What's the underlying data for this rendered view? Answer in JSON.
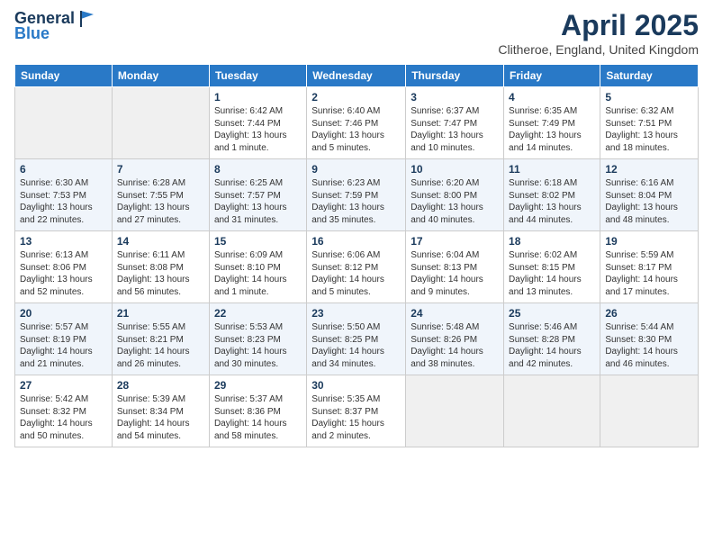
{
  "header": {
    "logo_line1": "General",
    "logo_line2": "Blue",
    "title": "April 2025",
    "subtitle": "Clitheroe, England, United Kingdom"
  },
  "days_of_week": [
    "Sunday",
    "Monday",
    "Tuesday",
    "Wednesday",
    "Thursday",
    "Friday",
    "Saturday"
  ],
  "weeks": [
    [
      {
        "day": "",
        "info": ""
      },
      {
        "day": "",
        "info": ""
      },
      {
        "day": "1",
        "info": "Sunrise: 6:42 AM\nSunset: 7:44 PM\nDaylight: 13 hours and 1 minute."
      },
      {
        "day": "2",
        "info": "Sunrise: 6:40 AM\nSunset: 7:46 PM\nDaylight: 13 hours and 5 minutes."
      },
      {
        "day": "3",
        "info": "Sunrise: 6:37 AM\nSunset: 7:47 PM\nDaylight: 13 hours and 10 minutes."
      },
      {
        "day": "4",
        "info": "Sunrise: 6:35 AM\nSunset: 7:49 PM\nDaylight: 13 hours and 14 minutes."
      },
      {
        "day": "5",
        "info": "Sunrise: 6:32 AM\nSunset: 7:51 PM\nDaylight: 13 hours and 18 minutes."
      }
    ],
    [
      {
        "day": "6",
        "info": "Sunrise: 6:30 AM\nSunset: 7:53 PM\nDaylight: 13 hours and 22 minutes."
      },
      {
        "day": "7",
        "info": "Sunrise: 6:28 AM\nSunset: 7:55 PM\nDaylight: 13 hours and 27 minutes."
      },
      {
        "day": "8",
        "info": "Sunrise: 6:25 AM\nSunset: 7:57 PM\nDaylight: 13 hours and 31 minutes."
      },
      {
        "day": "9",
        "info": "Sunrise: 6:23 AM\nSunset: 7:59 PM\nDaylight: 13 hours and 35 minutes."
      },
      {
        "day": "10",
        "info": "Sunrise: 6:20 AM\nSunset: 8:00 PM\nDaylight: 13 hours and 40 minutes."
      },
      {
        "day": "11",
        "info": "Sunrise: 6:18 AM\nSunset: 8:02 PM\nDaylight: 13 hours and 44 minutes."
      },
      {
        "day": "12",
        "info": "Sunrise: 6:16 AM\nSunset: 8:04 PM\nDaylight: 13 hours and 48 minutes."
      }
    ],
    [
      {
        "day": "13",
        "info": "Sunrise: 6:13 AM\nSunset: 8:06 PM\nDaylight: 13 hours and 52 minutes."
      },
      {
        "day": "14",
        "info": "Sunrise: 6:11 AM\nSunset: 8:08 PM\nDaylight: 13 hours and 56 minutes."
      },
      {
        "day": "15",
        "info": "Sunrise: 6:09 AM\nSunset: 8:10 PM\nDaylight: 14 hours and 1 minute."
      },
      {
        "day": "16",
        "info": "Sunrise: 6:06 AM\nSunset: 8:12 PM\nDaylight: 14 hours and 5 minutes."
      },
      {
        "day": "17",
        "info": "Sunrise: 6:04 AM\nSunset: 8:13 PM\nDaylight: 14 hours and 9 minutes."
      },
      {
        "day": "18",
        "info": "Sunrise: 6:02 AM\nSunset: 8:15 PM\nDaylight: 14 hours and 13 minutes."
      },
      {
        "day": "19",
        "info": "Sunrise: 5:59 AM\nSunset: 8:17 PM\nDaylight: 14 hours and 17 minutes."
      }
    ],
    [
      {
        "day": "20",
        "info": "Sunrise: 5:57 AM\nSunset: 8:19 PM\nDaylight: 14 hours and 21 minutes."
      },
      {
        "day": "21",
        "info": "Sunrise: 5:55 AM\nSunset: 8:21 PM\nDaylight: 14 hours and 26 minutes."
      },
      {
        "day": "22",
        "info": "Sunrise: 5:53 AM\nSunset: 8:23 PM\nDaylight: 14 hours and 30 minutes."
      },
      {
        "day": "23",
        "info": "Sunrise: 5:50 AM\nSunset: 8:25 PM\nDaylight: 14 hours and 34 minutes."
      },
      {
        "day": "24",
        "info": "Sunrise: 5:48 AM\nSunset: 8:26 PM\nDaylight: 14 hours and 38 minutes."
      },
      {
        "day": "25",
        "info": "Sunrise: 5:46 AM\nSunset: 8:28 PM\nDaylight: 14 hours and 42 minutes."
      },
      {
        "day": "26",
        "info": "Sunrise: 5:44 AM\nSunset: 8:30 PM\nDaylight: 14 hours and 46 minutes."
      }
    ],
    [
      {
        "day": "27",
        "info": "Sunrise: 5:42 AM\nSunset: 8:32 PM\nDaylight: 14 hours and 50 minutes."
      },
      {
        "day": "28",
        "info": "Sunrise: 5:39 AM\nSunset: 8:34 PM\nDaylight: 14 hours and 54 minutes."
      },
      {
        "day": "29",
        "info": "Sunrise: 5:37 AM\nSunset: 8:36 PM\nDaylight: 14 hours and 58 minutes."
      },
      {
        "day": "30",
        "info": "Sunrise: 5:35 AM\nSunset: 8:37 PM\nDaylight: 15 hours and 2 minutes."
      },
      {
        "day": "",
        "info": ""
      },
      {
        "day": "",
        "info": ""
      },
      {
        "day": "",
        "info": ""
      }
    ]
  ]
}
